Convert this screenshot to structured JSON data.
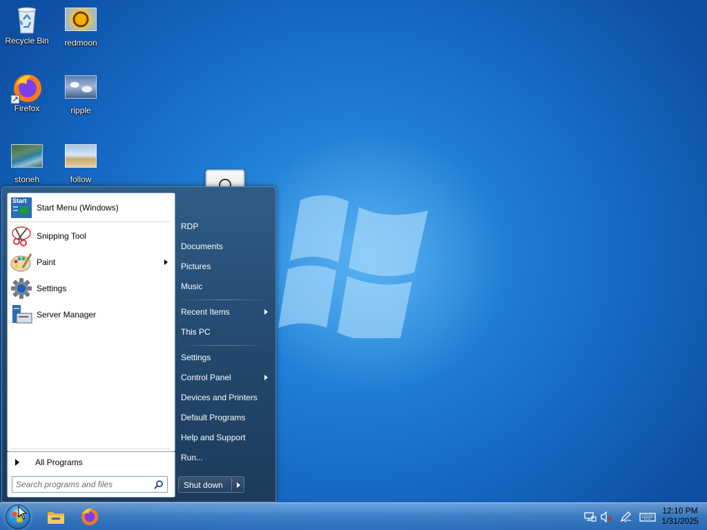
{
  "desktop": {
    "icons": [
      {
        "label": "Recycle Bin",
        "icon": "recycle-bin-icon"
      },
      {
        "label": "redmoon",
        "icon": "image-file-icon"
      },
      {
        "label": "Firefox",
        "icon": "firefox-icon"
      },
      {
        "label": "ripple",
        "icon": "image-file-icon"
      },
      {
        "label": "stoneh",
        "icon": "image-file-icon"
      },
      {
        "label": "follow",
        "icon": "image-file-icon"
      }
    ]
  },
  "start_menu": {
    "pinned": [
      {
        "label": "Start Menu (Windows)",
        "icon": "start-menu-app-icon"
      },
      {
        "label": "Snipping Tool",
        "icon": "scissors-icon"
      },
      {
        "label": "Paint",
        "icon": "palette-icon",
        "has_submenu": true
      },
      {
        "label": "Settings",
        "icon": "gear-icon"
      },
      {
        "label": "Server Manager",
        "icon": "server-icon"
      }
    ],
    "start_icon_text": "Start",
    "all_programs": "All Programs",
    "search_placeholder": "Search programs and files",
    "right_items": [
      {
        "label": "RDP"
      },
      {
        "label": "Documents"
      },
      {
        "label": "Pictures"
      },
      {
        "label": "Music"
      },
      {
        "label": "Recent Items",
        "has_submenu": true
      },
      {
        "label": "This PC"
      },
      {
        "label": "Settings"
      },
      {
        "label": "Control Panel",
        "has_submenu": true
      },
      {
        "label": "Devices and Printers"
      },
      {
        "label": "Default Programs"
      },
      {
        "label": "Help and Support"
      },
      {
        "label": "Run..."
      }
    ],
    "shutdown": "Shut down"
  },
  "taskbar": {
    "pinned": [
      "folder-icon",
      "firefox-icon"
    ],
    "tray": [
      "network-icon",
      "volume-muted-icon",
      "pen-icon",
      "keyboard-icon"
    ],
    "time": "12:10 PM",
    "date": "1/31/2025"
  },
  "colors": {
    "desktop_blue": "#1f7fd6",
    "menu_blue": "#2f5d87",
    "accent_red": "#e02020"
  }
}
